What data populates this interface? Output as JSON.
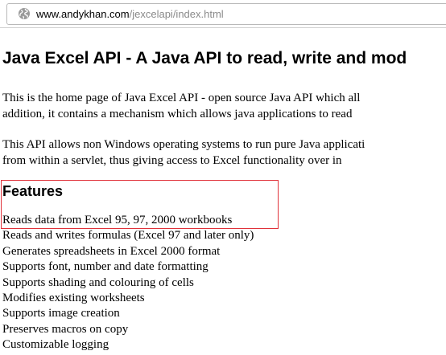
{
  "browser": {
    "url_domain": "www.andykhan.com",
    "url_path": "/jexcelapi/index.html",
    "site_icon": "globe-icon"
  },
  "page": {
    "title": "Java Excel API - A Java API to read, write and mod",
    "paragraph1": {
      "line1": "This is the home page of Java Excel API - open source Java API which all",
      "line2": "addition, it contains a mechanism which allows java applications to read"
    },
    "paragraph2": {
      "line1": "This API allows non Windows operating systems to run pure Java applicati",
      "line2": "from within a servlet, thus giving access to Excel functionality over in"
    },
    "features_heading": "Features",
    "features": [
      "Reads data from Excel 95, 97, 2000 workbooks",
      "Reads and writes formulas (Excel 97 and later only)",
      "Generates spreadsheets in Excel 2000 format",
      "Supports font, number and date formatting",
      "Supports shading and colouring of cells",
      "Modifies existing worksheets",
      "Supports image creation",
      "Preserves macros on copy",
      "Customizable logging"
    ]
  },
  "colors": {
    "highlight": "#e0323a",
    "url_path": "#8a8a8a"
  }
}
